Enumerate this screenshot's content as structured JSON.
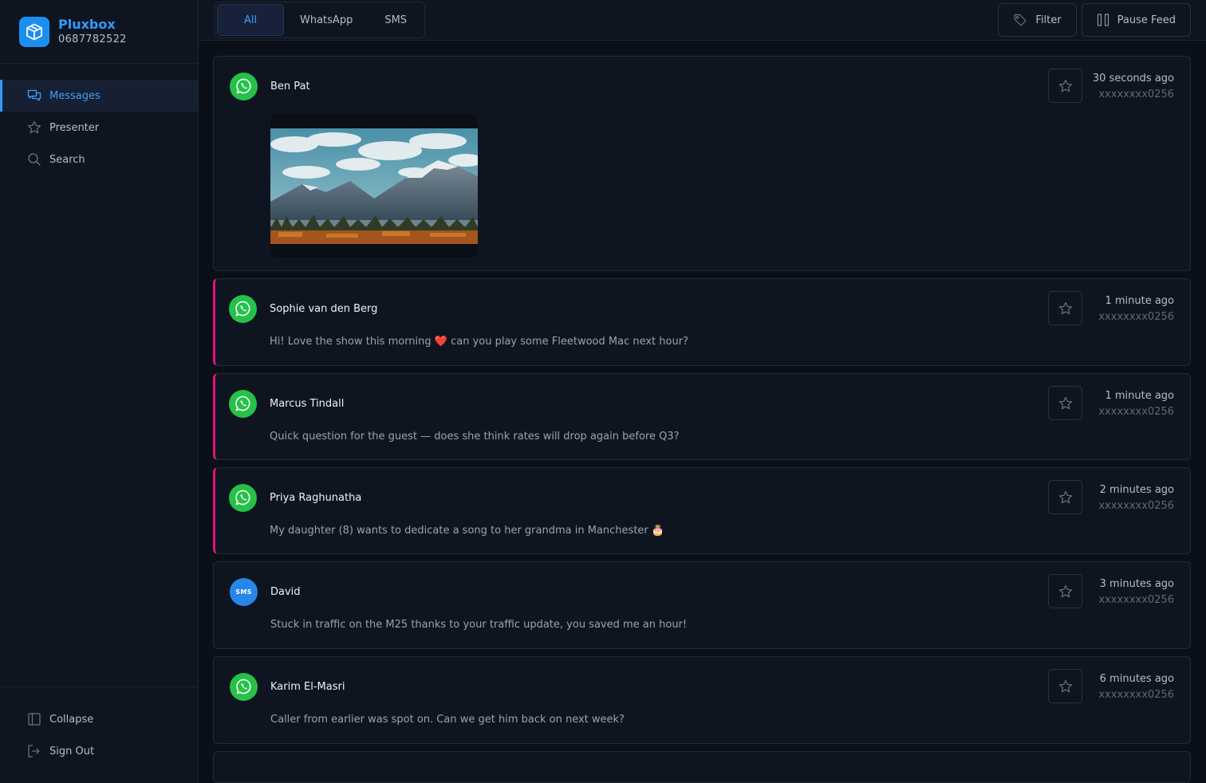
{
  "brand": {
    "name": "Pluxbox",
    "phone": "0687782522"
  },
  "sidebar": {
    "items": [
      {
        "label": "Messages",
        "icon": "chat-icon",
        "active": true
      },
      {
        "label": "Presenter",
        "icon": "star-icon",
        "active": false
      },
      {
        "label": "Search",
        "icon": "search-icon",
        "active": false
      }
    ],
    "bottom": [
      {
        "label": "Collapse",
        "icon": "sidebar-collapse-icon"
      },
      {
        "label": "Sign Out",
        "icon": "sign-out-icon"
      }
    ]
  },
  "tabs": [
    {
      "label": "All",
      "active": true
    },
    {
      "label": "WhatsApp",
      "active": false
    },
    {
      "label": "SMS",
      "active": false
    }
  ],
  "actions": {
    "filter_label": "Filter",
    "pause_label": "Pause Feed"
  },
  "colors": {
    "accent": "#2f9bff",
    "whatsapp": "#25c149",
    "sms": "#2787e8",
    "flag": "#e3127d"
  },
  "messages": [
    {
      "sender": "Ben Pat",
      "channel": "whatsapp",
      "time": "30 seconds ago",
      "number": "xxxxxxxx0256",
      "text": "",
      "has_image": true,
      "flagged": false
    },
    {
      "sender": "Sophie van den Berg",
      "channel": "whatsapp",
      "time": "1 minute ago",
      "number": "xxxxxxxx0256",
      "text": "Hi! Love the show this morning ❤️ can you play some Fleetwood Mac next hour?",
      "flagged": true
    },
    {
      "sender": "Marcus Tindall",
      "channel": "whatsapp",
      "time": "1 minute ago",
      "number": "xxxxxxxx0256",
      "text": "Quick question for the guest — does she think rates will drop again before Q3?",
      "flagged": true
    },
    {
      "sender": "Priya Raghunatha",
      "channel": "whatsapp",
      "time": "2 minutes ago",
      "number": "xxxxxxxx0256",
      "text": "My daughter (8) wants to dedicate a song to her grandma in Manchester 🎂",
      "flagged": true
    },
    {
      "sender": "David",
      "channel": "sms",
      "sms_badge": "SMS",
      "time": "3 minutes ago",
      "number": "xxxxxxxx0256",
      "text": "Stuck in traffic on the M25 thanks to your traffic update, you saved me an hour!",
      "flagged": false
    },
    {
      "sender": "Karim El-Masri",
      "channel": "whatsapp",
      "time": "6 minutes ago",
      "number": "xxxxxxxx0256",
      "text": "Caller from earlier was spot on. Can we get him back on next week?",
      "flagged": false
    }
  ]
}
